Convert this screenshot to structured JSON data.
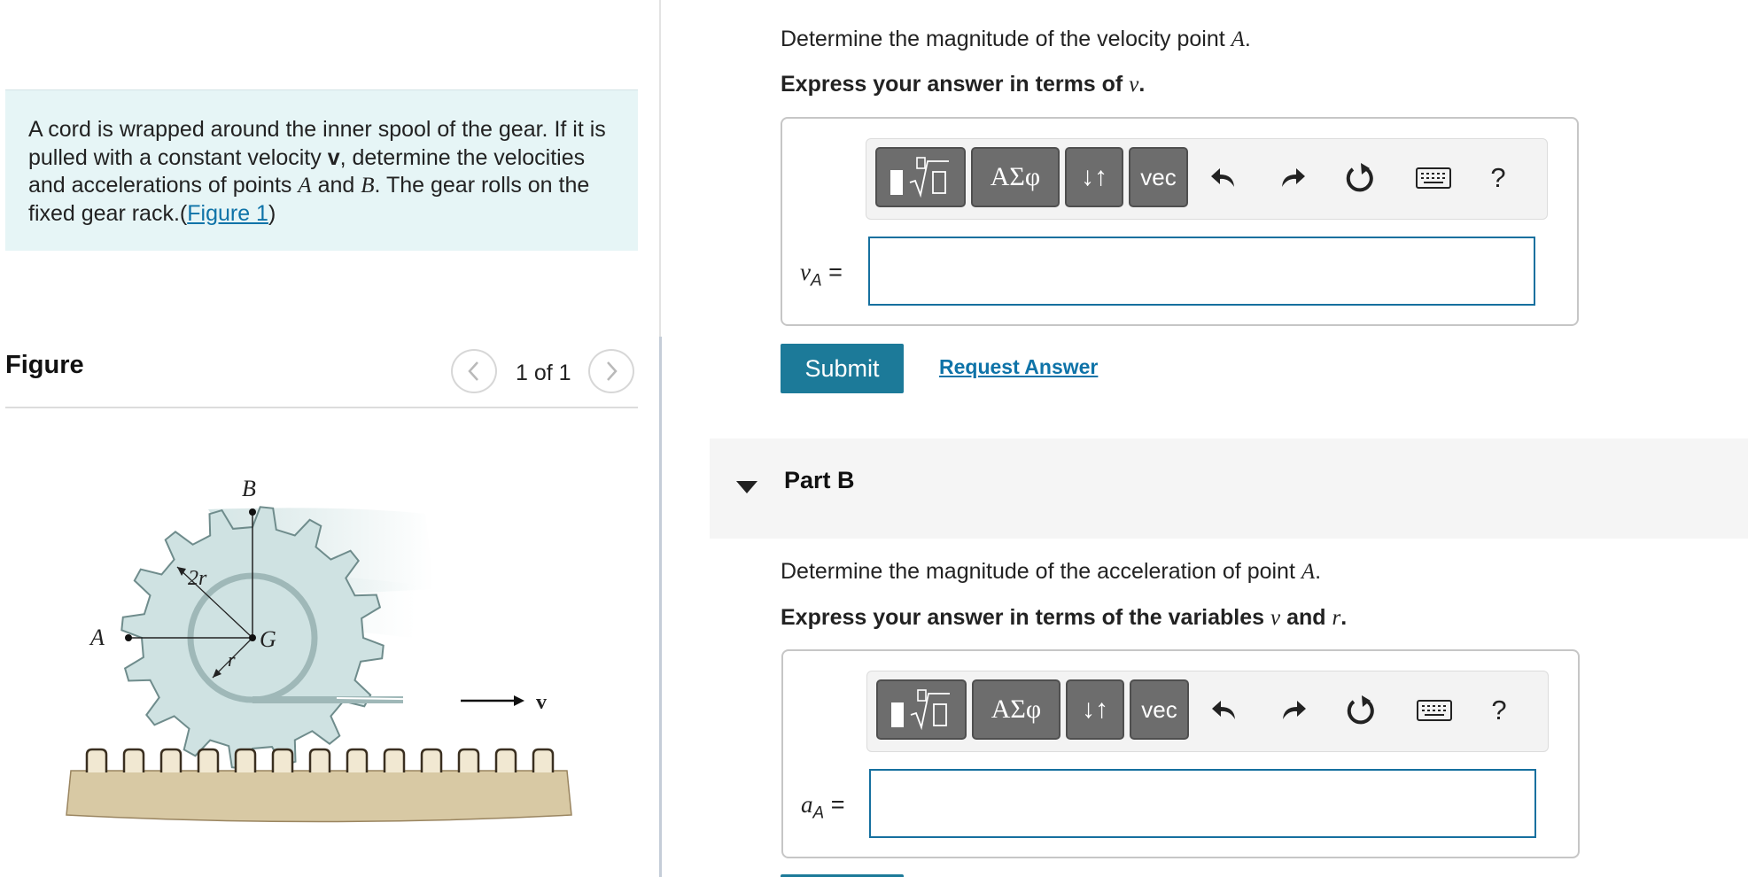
{
  "problem": {
    "text_1": "A cord is wrapped around the inner spool of the gear. If it is pulled with a constant velocity ",
    "bold_v": "v",
    "text_2": ", determine the velocities and accelerations of points ",
    "point_a": "A",
    "text_3": " and ",
    "point_b": "B",
    "text_4": ". The gear rolls on the fixed gear rack.(",
    "figure_link": "Figure 1",
    "text_5": ")"
  },
  "figure_panel": {
    "title": "Figure",
    "counter": "1 of 1",
    "prev_icon": "chevron-left-icon",
    "next_icon": "chevron-right-icon",
    "labels": {
      "b": "B",
      "a": "A",
      "g": "G",
      "two_r": "2r",
      "r": "r",
      "v": "v"
    },
    "colors": {
      "gear": "#cfe2e2",
      "gear_stroke": "#6f8c8c",
      "rack": "#d8c9a4",
      "rack_stroke": "#9a8560"
    }
  },
  "part_a": {
    "question_1": "Determine the magnitude of the velocity point ",
    "question_var": "A",
    "question_2": ".",
    "instruction_1": "Express your answer in terms of ",
    "instruction_var": "v",
    "instruction_2": ".",
    "var_main": "v",
    "var_sub": "A",
    "equals": " =",
    "input_value": "",
    "submit_label": "Submit",
    "request_label": "Request Answer"
  },
  "toolbar": {
    "symbols_label": "ΑΣφ",
    "arrows_label": "↓↑",
    "vec_label": "vec",
    "help_label": "?",
    "icons": [
      "templates-icon",
      "undo-icon",
      "redo-icon",
      "reset-icon",
      "keyboard-icon"
    ]
  },
  "part_b": {
    "title": "Part B",
    "question_1": "Determine the magnitude of the acceleration of point ",
    "question_var": "A",
    "question_2": ".",
    "instruction_1": "Express your answer in terms of the variables ",
    "instruction_var1": "v",
    "instruction_mid": " and ",
    "instruction_var2": "r",
    "instruction_2": ".",
    "var_main": "a",
    "var_sub": "A",
    "equals": " =",
    "input_value": ""
  },
  "colors": {
    "accent": "#1c7a99",
    "link": "#0e73a8",
    "problem_bg": "#e6f5f6",
    "input_border": "#16709f"
  }
}
